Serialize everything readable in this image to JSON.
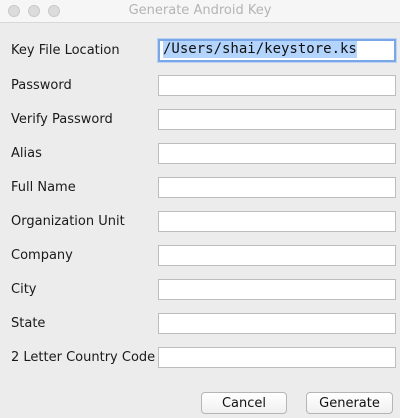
{
  "window": {
    "title": "Generate Android Key"
  },
  "form": {
    "fields": [
      {
        "label": "Key File Location",
        "value": "/Users/shai/keystore.ks"
      },
      {
        "label": "Password",
        "value": ""
      },
      {
        "label": "Verify Password",
        "value": ""
      },
      {
        "label": "Alias",
        "value": ""
      },
      {
        "label": "Full Name",
        "value": ""
      },
      {
        "label": "Organization Unit",
        "value": ""
      },
      {
        "label": "Company",
        "value": ""
      },
      {
        "label": "City",
        "value": ""
      },
      {
        "label": "State",
        "value": ""
      },
      {
        "label": "2 Letter Country Code",
        "value": ""
      }
    ]
  },
  "buttons": {
    "cancel": "Cancel",
    "generate": "Generate"
  }
}
